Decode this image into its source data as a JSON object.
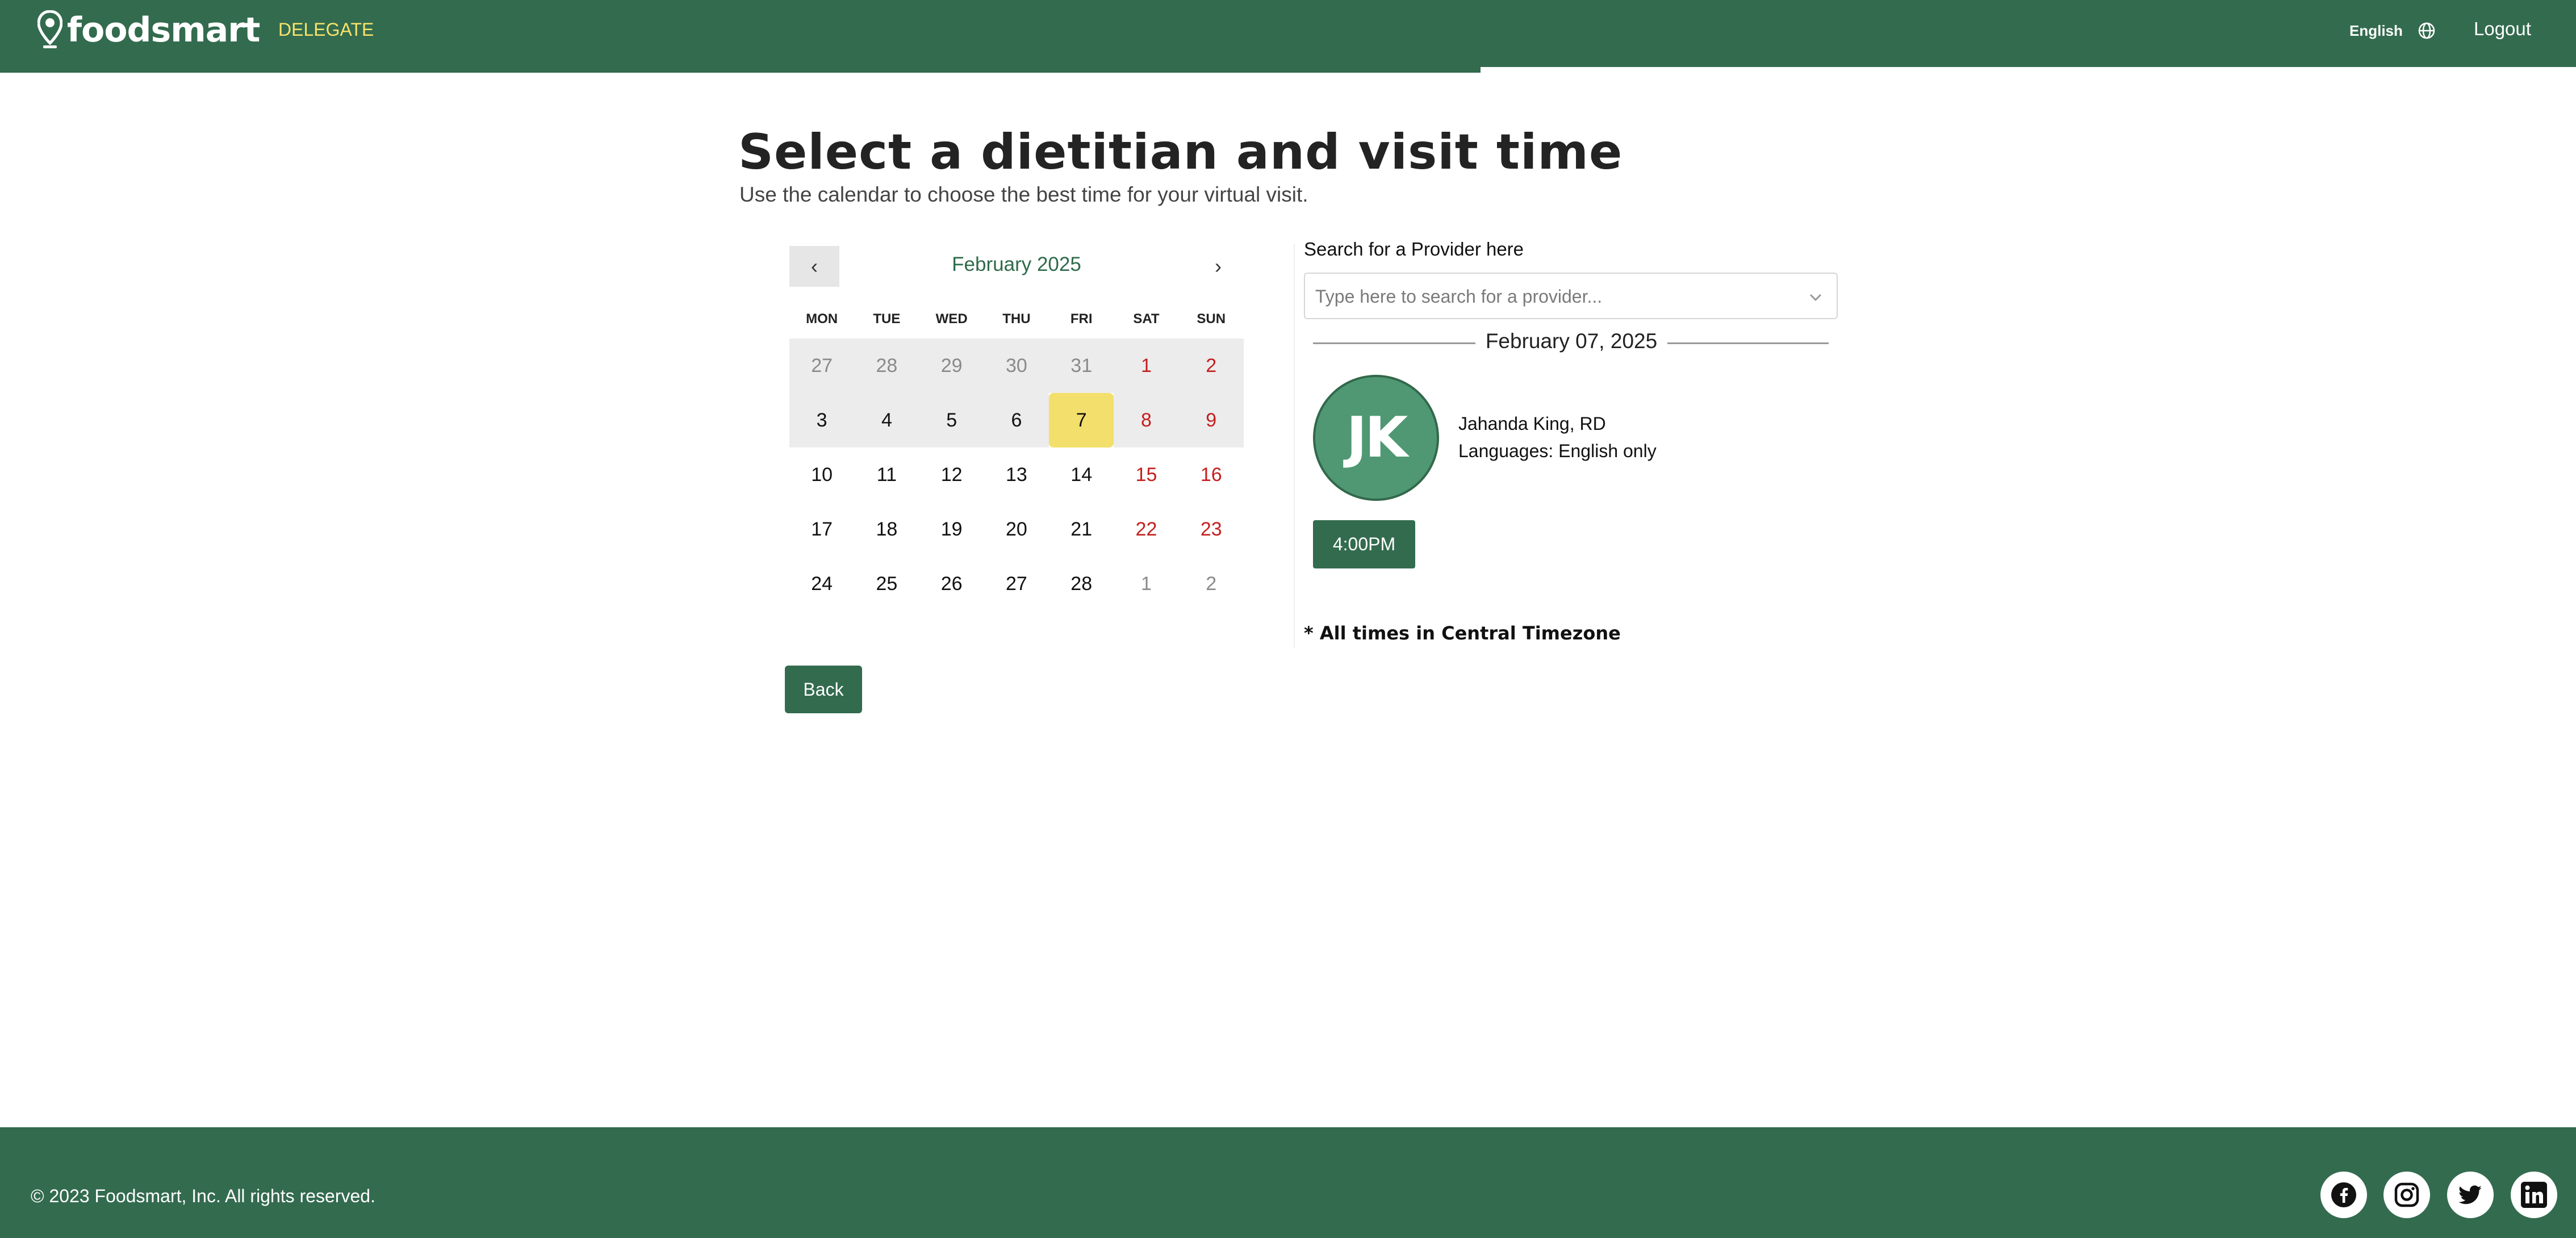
{
  "header": {
    "brand": "foodsmart",
    "delegate_label": "DELEGATE",
    "language_label": "English",
    "logout_label": "Logout"
  },
  "page": {
    "title": "Select a dietitian and visit time",
    "subtitle": "Use the calendar to choose the best time for your virtual visit."
  },
  "calendar": {
    "prev_label": "‹",
    "next_label": "›",
    "month_label": "February 2025",
    "weekdays": [
      "MON",
      "TUE",
      "WED",
      "THU",
      "FRI",
      "SAT",
      "SUN"
    ],
    "selected_day": "7",
    "days": [
      [
        "27",
        "28",
        "29",
        "30",
        "31",
        "1",
        "2"
      ],
      [
        "3",
        "4",
        "5",
        "6",
        "7",
        "8",
        "9"
      ],
      [
        "10",
        "11",
        "12",
        "13",
        "14",
        "15",
        "16"
      ],
      [
        "17",
        "18",
        "19",
        "20",
        "21",
        "22",
        "23"
      ],
      [
        "24",
        "25",
        "26",
        "27",
        "28",
        "1",
        "2"
      ]
    ]
  },
  "buttons": {
    "back_label": "Back"
  },
  "provider_search": {
    "label": "Search for a Provider here",
    "placeholder": "Type here to search for a provider..."
  },
  "availability": {
    "date_label": "February 07, 2025",
    "provider": {
      "initials": "JK",
      "name": "Jahanda King, RD",
      "languages": "Languages: English only"
    },
    "time_slots": [
      "4:00PM"
    ],
    "timezone_note": "* All times in Central Timezone"
  },
  "footer": {
    "copyright": "© 2023 Foodsmart, Inc. All rights reserved.",
    "social_icons": [
      "facebook-icon",
      "instagram-icon",
      "twitter-icon",
      "linkedin-icon"
    ]
  },
  "colors": {
    "brand_green": "#336b4e",
    "avatar_green": "#4f9873",
    "delegate_yellow": "#f6e36b",
    "selected_day_yellow": "#f3df6b",
    "weekend_red": "#c51f1f"
  }
}
